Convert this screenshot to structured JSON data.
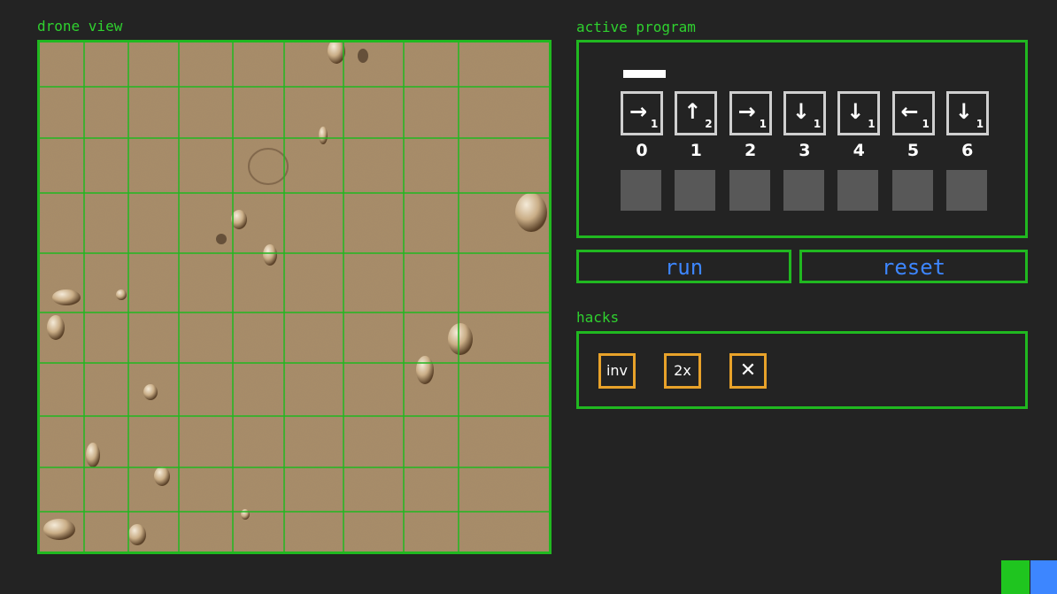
{
  "drone_view": {
    "label": "drone view"
  },
  "program": {
    "label": "active program",
    "cursor_slot": 0,
    "slots": [
      {
        "index": "0",
        "arrow": "→",
        "arrow_icon": "arrow-right-icon",
        "count": "1"
      },
      {
        "index": "1",
        "arrow": "↑",
        "arrow_icon": "arrow-up-icon",
        "count": "2"
      },
      {
        "index": "2",
        "arrow": "→",
        "arrow_icon": "arrow-right-icon",
        "count": "1"
      },
      {
        "index": "3",
        "arrow": "↓",
        "arrow_icon": "arrow-down-icon",
        "count": "1"
      },
      {
        "index": "4",
        "arrow": "↓",
        "arrow_icon": "arrow-down-icon",
        "count": "1"
      },
      {
        "index": "5",
        "arrow": "←",
        "arrow_icon": "arrow-left-icon",
        "count": "1"
      },
      {
        "index": "6",
        "arrow": "↓",
        "arrow_icon": "arrow-down-icon",
        "count": "1"
      }
    ]
  },
  "controls": {
    "run_label": "run",
    "reset_label": "reset"
  },
  "hacks": {
    "label": "hacks",
    "buttons": {
      "inv": "inv",
      "double": "2x",
      "clear": "✕"
    }
  },
  "colors": {
    "background": "#232323",
    "accent_green": "#20b820",
    "label_green": "#2fd12f",
    "button_text_blue": "#3d86ff",
    "hack_border_orange": "#e8a22a",
    "swatch_green": "#1fc51f",
    "swatch_blue": "#3d86ff"
  }
}
